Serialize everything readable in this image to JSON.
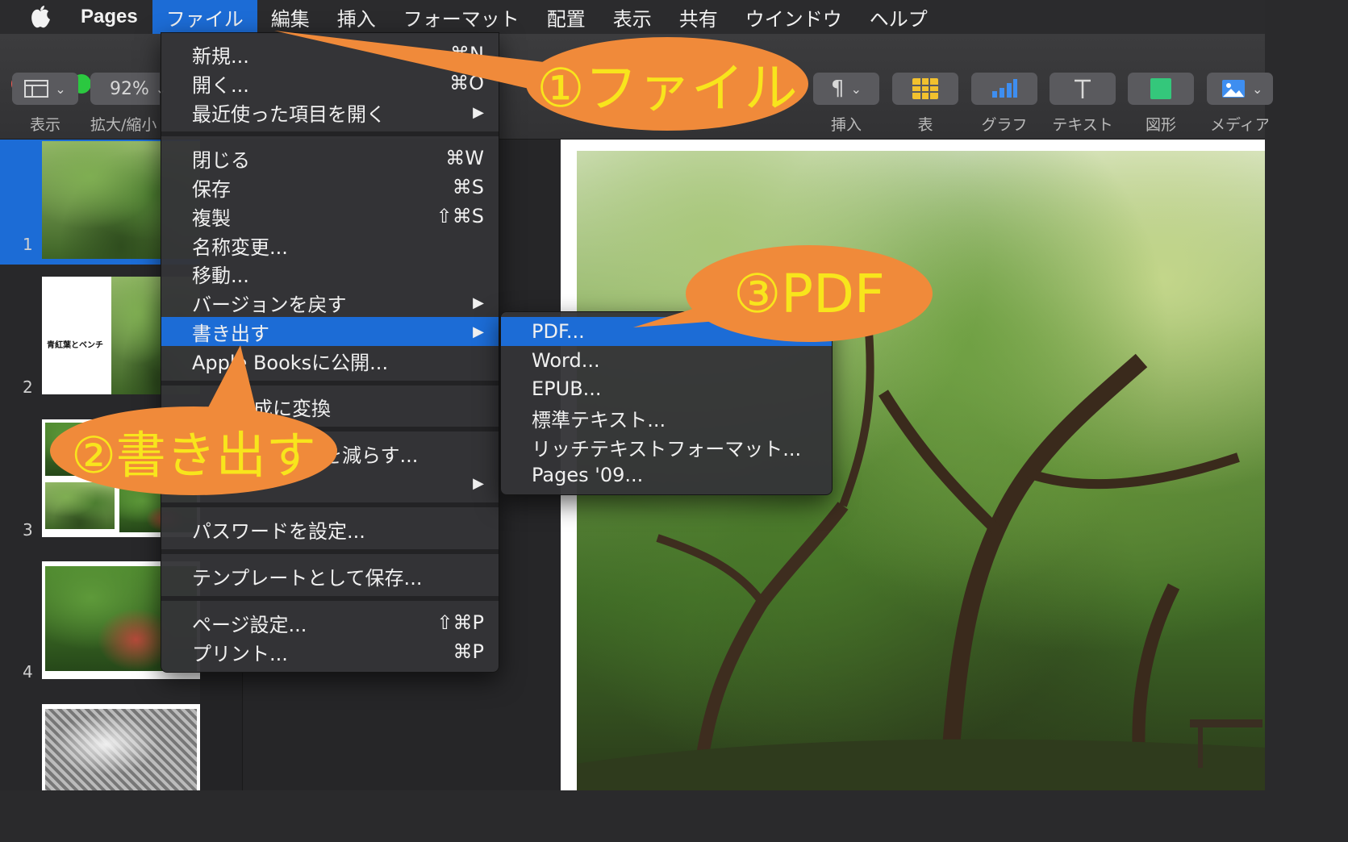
{
  "menubar": {
    "app_name": "Pages",
    "items": [
      "ファイル",
      "編集",
      "挿入",
      "フォーマット",
      "配置",
      "表示",
      "共有",
      "ウインドウ",
      "ヘルプ"
    ]
  },
  "toolbar": {
    "view_label": "表示",
    "zoom_value": "92%",
    "zoom_label": "拡大/縮小",
    "insert_label": "挿入",
    "table_label": "表",
    "chart_label": "グラフ",
    "text_label": "テキスト",
    "shape_label": "図形",
    "media_label": "メディア"
  },
  "sidebar": {
    "pages": [
      "1",
      "2",
      "3",
      "4"
    ],
    "page2_title": "青紅葉とベンチ"
  },
  "file_menu": {
    "new": "新規...",
    "new_sc": "⌘N",
    "open": "開く...",
    "open_sc": "⌘O",
    "recent": "最近使った項目を開く",
    "close": "閉じる",
    "close_sc": "⌘W",
    "save": "保存",
    "save_sc": "⌘S",
    "duplicate": "複製",
    "duplicate_sc": "⇧⌘S",
    "rename": "名称変更...",
    "move": "移動...",
    "revert": "バージョンを戻す",
    "export": "書き出す",
    "publish": "Apple Booksに公開...",
    "convert": "作成に変換",
    "reduce": "を減らす...",
    "password": "パスワードを設定...",
    "template": "テンプレートとして保存...",
    "page_setup": "ページ設定...",
    "page_setup_sc": "⇧⌘P",
    "print": "プリント...",
    "print_sc": "⌘P"
  },
  "export_submenu": {
    "items": [
      "PDF...",
      "Word...",
      "EPUB...",
      "標準テキスト...",
      "リッチテキストフォーマット...",
      "Pages '09..."
    ]
  },
  "annotations": {
    "step1": "①ファイル",
    "step2": "②書き出す",
    "step3": "③PDF"
  },
  "colors": {
    "accent": "#1c6cd6",
    "callout_fill": "#f08a3a",
    "callout_text": "#f8e51c"
  }
}
